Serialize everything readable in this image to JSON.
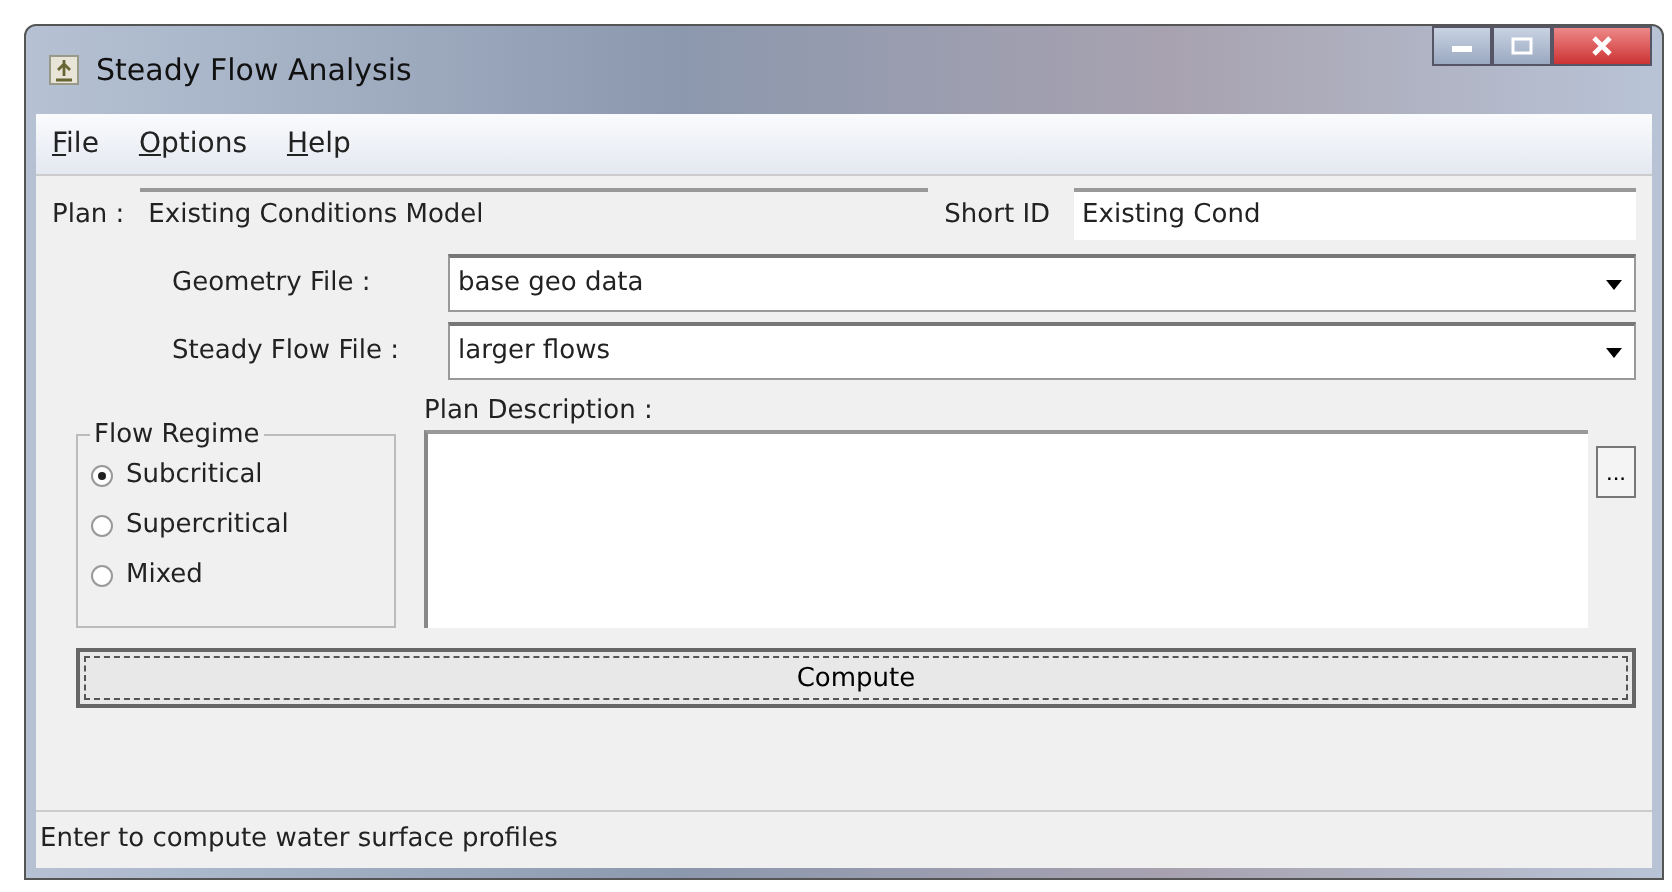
{
  "window": {
    "title": "Steady Flow Analysis"
  },
  "menu": [
    "File",
    "Options",
    "Help"
  ],
  "plan": {
    "label": "Plan :",
    "value": "Existing Conditions Model"
  },
  "short_id": {
    "label": "Short ID",
    "value": "Existing Cond"
  },
  "selects": [
    {
      "label": "Geometry File :",
      "value": "base geo data"
    },
    {
      "label": "Steady Flow File :",
      "value": "larger flows"
    }
  ],
  "flow_regime": {
    "title": "Flow Regime",
    "options": [
      {
        "label": "Subcritical",
        "selected": true
      },
      {
        "label": "Supercritical",
        "selected": false
      },
      {
        "label": "Mixed",
        "selected": false
      }
    ]
  },
  "plan_description": {
    "label": "Plan Description :",
    "button": "..."
  },
  "compute_button": "Compute",
  "status_bar": "Enter to compute water surface profiles"
}
